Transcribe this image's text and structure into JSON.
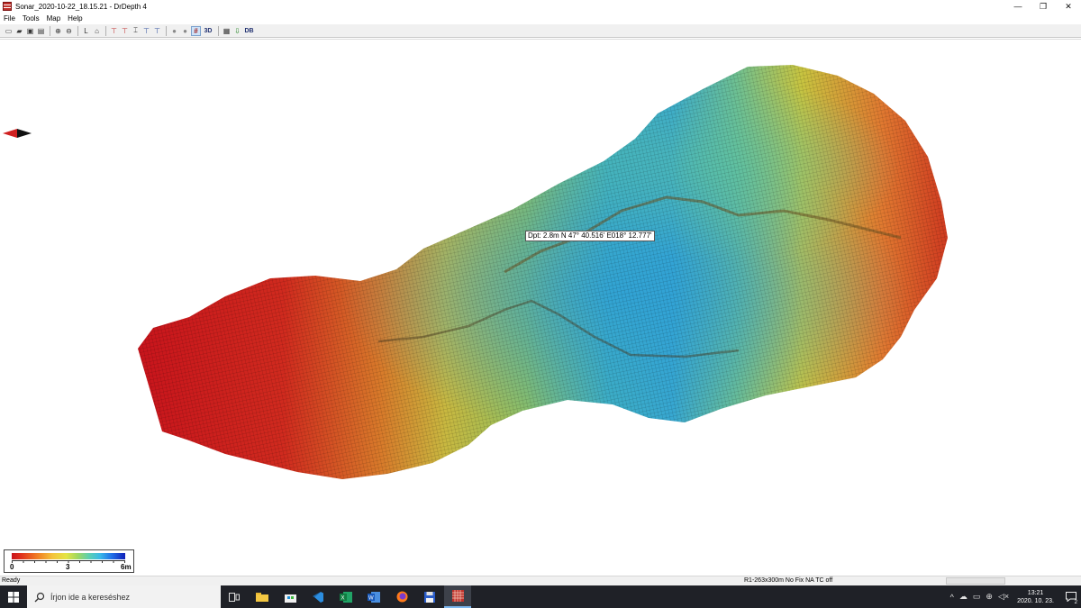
{
  "window": {
    "title": "Sonar_2020-10-22_18.15.21 - DrDepth 4",
    "controls": {
      "minimize": "—",
      "restore": "❐",
      "close": "✕"
    }
  },
  "menu": {
    "items": [
      "File",
      "Tools",
      "Map",
      "Help"
    ]
  },
  "toolbar": {
    "buttons": [
      {
        "icon": "new-file-icon",
        "glyph": "▭"
      },
      {
        "icon": "open-folder-icon",
        "glyph": "▰"
      },
      {
        "icon": "save-icon",
        "glyph": "▣"
      },
      {
        "icon": "save-all-icon",
        "glyph": "▤"
      },
      {
        "icon": "zoom-in-icon",
        "glyph": "⊕"
      },
      {
        "icon": "zoom-out-icon",
        "glyph": "⊖"
      },
      {
        "icon": "measure-icon",
        "glyph": "L"
      },
      {
        "icon": "profile-icon",
        "glyph": "⌂"
      },
      {
        "icon": "marker-1-icon",
        "glyph": "⊤"
      },
      {
        "icon": "marker-2-icon",
        "glyph": "⊤"
      },
      {
        "icon": "marker-3-icon",
        "glyph": "⌶"
      },
      {
        "icon": "marker-4-icon",
        "glyph": "⊤"
      },
      {
        "icon": "marker-5-icon",
        "glyph": "⊤"
      },
      {
        "icon": "circle-1-icon",
        "glyph": "●"
      },
      {
        "icon": "circle-2-icon",
        "glyph": "●"
      },
      {
        "icon": "grid-mesh-icon",
        "glyph": "#"
      },
      {
        "icon": "view-3d-icon",
        "glyph": "3D"
      },
      {
        "icon": "report-icon",
        "glyph": "▦"
      },
      {
        "icon": "export-icon",
        "glyph": "⇩"
      },
      {
        "icon": "database-icon",
        "glyph": "DB"
      }
    ]
  },
  "map": {
    "tooltip": "Dpt: 2.8m N 47° 40.516' E018° 12.777'",
    "legend": {
      "min_label": "0",
      "mid_label": "3",
      "max_label": "6m"
    },
    "colors": {
      "shallow": "#c8141c",
      "mid": "#e4e444",
      "deep": "#1020b8"
    }
  },
  "status": {
    "left": "Ready",
    "right": "R1-263x300m  No Fix    NA  TC off"
  },
  "taskbar": {
    "search_placeholder": "Írjon ide a kereséshez",
    "apps": [
      "task-view",
      "file-explorer",
      "store",
      "visual-studio-code",
      "excel",
      "word",
      "firefox",
      "floppy-save",
      "drdepth"
    ],
    "time": "13:21",
    "date": "2020. 10. 23.",
    "notifications": "2"
  }
}
